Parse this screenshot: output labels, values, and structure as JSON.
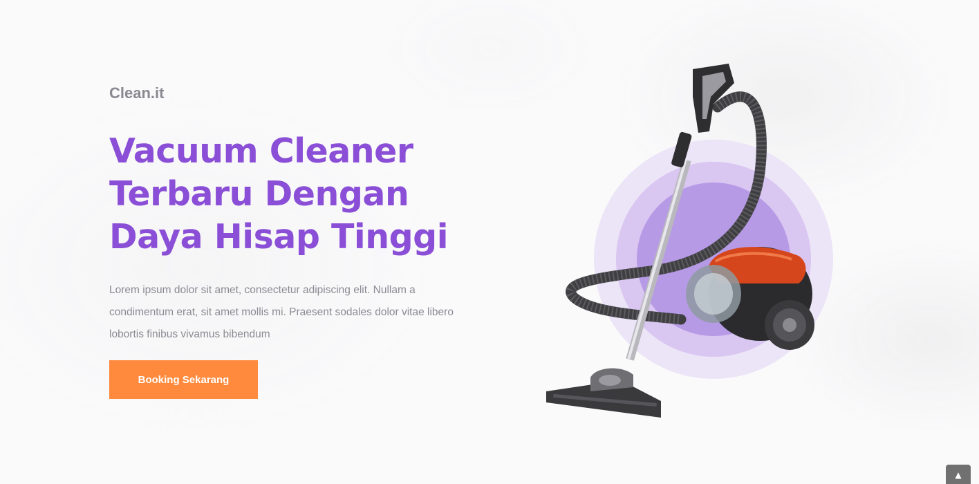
{
  "brand": "Clean.it",
  "hero": {
    "headline_lines": [
      "Vacuum Cleaner",
      "Terbaru Dengan",
      "Daya Hisap Tinggi"
    ],
    "description": "Lorem ipsum dolor sit amet, consectetur adipiscing elit. Nullam a condimentum erat, sit amet mollis mi. Praesent sodales dolor vitae libero lobortis finibus vivamus bibendum",
    "cta_label": "Booking Sekarang"
  },
  "colors": {
    "headline": "#8a4fd6",
    "cta_background": "#ff8a3d",
    "brand_text": "#8a8890",
    "circle_outer": "#ece4f7",
    "circle_middle": "#d9c6f1",
    "circle_inner": "#b79ae6"
  },
  "icons": {
    "scroll_top": "chevron-up-icon",
    "product": "vacuum-cleaner-icon"
  }
}
